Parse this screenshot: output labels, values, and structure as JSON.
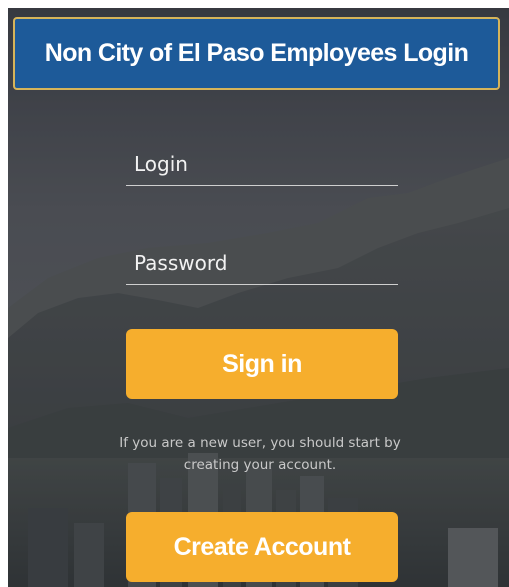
{
  "header": {
    "title": "Non City of El Paso Employees Login"
  },
  "form": {
    "login_placeholder": "Login",
    "password_placeholder": "Password",
    "sign_in_label": "Sign in",
    "new_user_hint": "If you are a new user, you should start by creating your account.",
    "create_account_label": "Create Account"
  },
  "colors": {
    "title_bar_bg": "#1d5a99",
    "title_bar_border": "#d6b45a",
    "button_bg": "#f6ae2d",
    "button_text": "#ffffff"
  }
}
